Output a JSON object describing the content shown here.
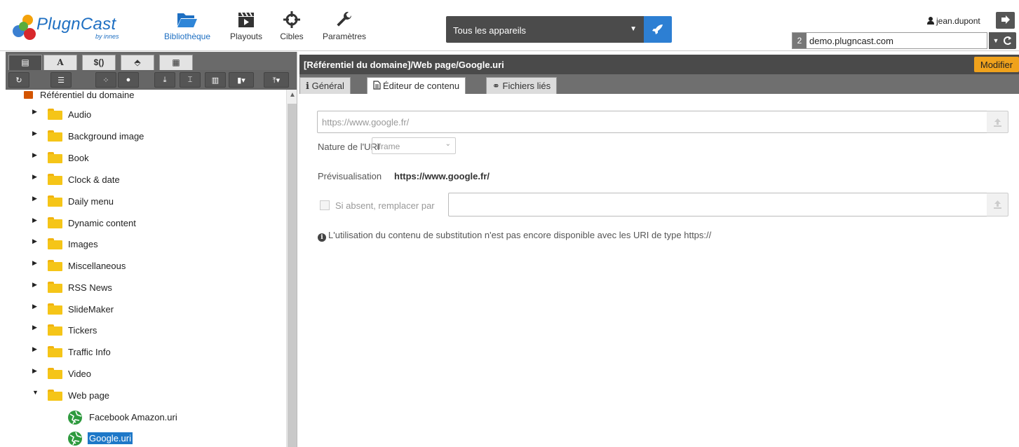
{
  "brand": {
    "name": "PlugnCast",
    "by": "by innes"
  },
  "nav": {
    "bibliotheque": "Bibliothèque",
    "playouts": "Playouts",
    "cibles": "Cibles",
    "parametres": "Paramètres"
  },
  "device_filter": {
    "selected": "Tous les appareils"
  },
  "user": {
    "name": "jean.dupont"
  },
  "domain": {
    "index": "2",
    "name": "demo.plugncast.com"
  },
  "left_tabs": [
    "",
    "A",
    "$()",
    "",
    ""
  ],
  "tree": {
    "root": "Référentiel du domaine",
    "folders": [
      "Audio",
      "Background image",
      "Book",
      "Clock & date",
      "Daily menu",
      "Dynamic content",
      "Images",
      "Miscellaneous",
      "RSS News",
      "SlideMaker",
      "Tickers",
      "Traffic Info",
      "Video",
      "Web page"
    ],
    "files": [
      "Facebook Amazon.uri",
      "Google.uri"
    ]
  },
  "content": {
    "title": "[Référentiel du domaine]/Web page/Google.uri",
    "modify_label": "Modifier",
    "tabs": {
      "general": "Général",
      "editor": "Éditeur de contenu",
      "files": "Fichiers liés"
    },
    "url_value": "https://www.google.fr/",
    "nature_label": "Nature de l'URI",
    "nature_value": "iframe",
    "preview_label": "Prévisualisation",
    "preview_value": "https://www.google.fr/",
    "substitute_label": "Si absent, remplacer par",
    "info_text": "L'utilisation du contenu de substitution n'est pas encore disponible avec les URI de type https://"
  },
  "colors": {
    "brand_blue": "#1e6fc2",
    "accent_orange": "#f0a21c",
    "folder_yellow": "#f5c518",
    "selection_blue": "#1e78c8",
    "dark_bar": "#4a4a4a"
  },
  "icons": [
    "folder-open-icon",
    "clapperboard-icon",
    "crosshair-icon",
    "wrench-icon",
    "rocket-icon",
    "user-icon",
    "logout-icon",
    "refresh-icon",
    "folder-icon",
    "globe-icon",
    "upload-icon",
    "info-icon"
  ]
}
